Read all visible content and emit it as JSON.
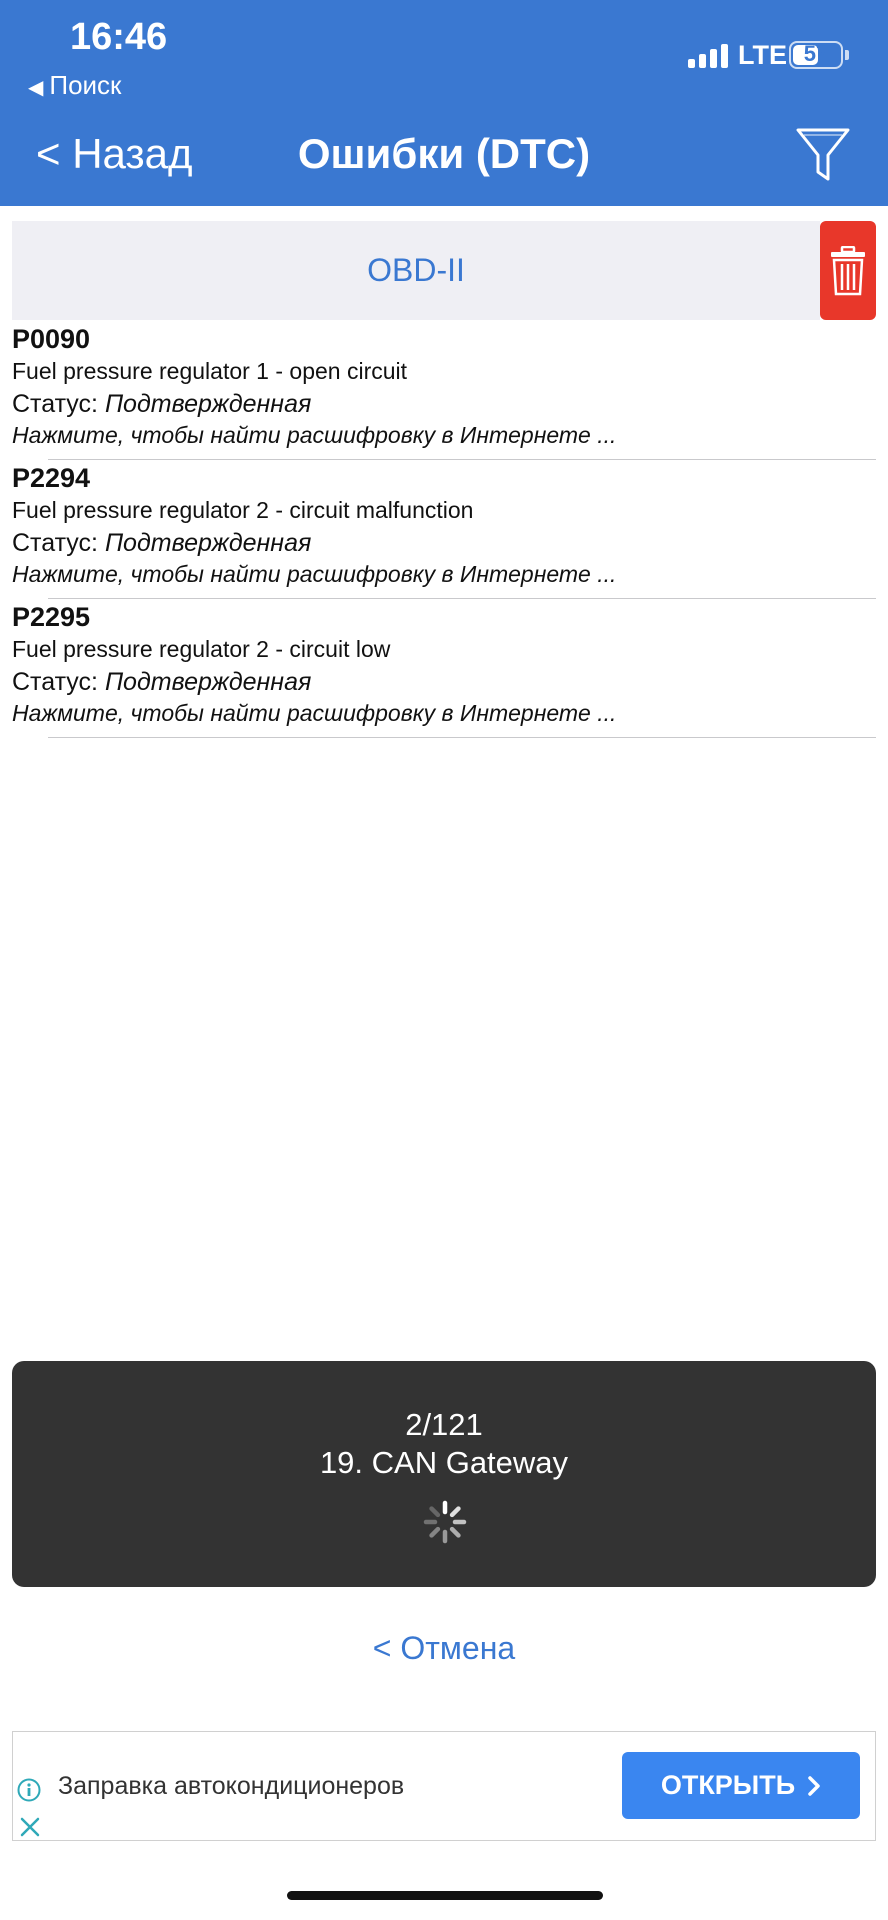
{
  "status_bar": {
    "time": "16:46",
    "back_app": "Поиск",
    "network": "LTE",
    "battery": "57",
    "battery_level": 0.57
  },
  "nav": {
    "back_label": "< Назад",
    "title": "Ошибки (DTC)",
    "filter_icon": "filter-icon"
  },
  "section": {
    "title": "OBD-II",
    "delete_icon": "trash-icon",
    "delete_color": "#e8372a"
  },
  "dtc_list": [
    {
      "code": "P0090",
      "description": "Fuel pressure regulator 1 - open circuit",
      "status_label": "Статус:",
      "status_value": "Подтвержденная",
      "hint": "Нажмите, чтобы найти расшифровку в Интернете ..."
    },
    {
      "code": "P2294",
      "description": "Fuel pressure regulator 2 - circuit malfunction",
      "status_label": "Статус:",
      "status_value": "Подтвержденная",
      "hint": "Нажмите, чтобы найти расшифровку в Интернете ..."
    },
    {
      "code": "P2295",
      "description": "Fuel pressure regulator 2 - circuit low",
      "status_label": "Статус:",
      "status_value": "Подтвержденная",
      "hint": "Нажмите, чтобы найти расшифровку в Интернете ..."
    }
  ],
  "progress": {
    "count": "2/121",
    "module": "19. CAN Gateway"
  },
  "cancel_label": "< Отмена",
  "ad": {
    "text": "Заправка автокондиционеров",
    "button_label": "ОТКРЫТЬ",
    "button_color": "#3a86f0"
  },
  "colors": {
    "accent": "#3a78d1",
    "header_bg": "#3a78d1",
    "section_bg": "#efeff4",
    "progress_bg": "#333333"
  }
}
